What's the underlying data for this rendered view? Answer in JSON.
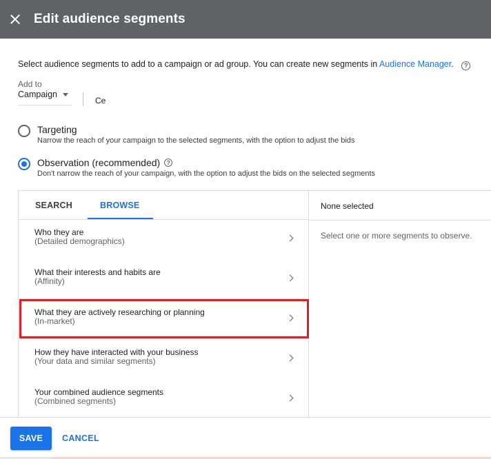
{
  "header": {
    "title": "Edit audience segments",
    "close_icon": "close-icon"
  },
  "intro": {
    "text": "Select audience segments to add to a campaign or ad group. You can create new segments in ",
    "link": "Audience Manager",
    "after": ".",
    "help_glyph": "?"
  },
  "add_to": {
    "label": "Add to",
    "value": "Campaign",
    "truncated": "Ce"
  },
  "options": {
    "targeting": {
      "title": "Targeting",
      "desc": "Narrow the reach of your campaign to the selected segments, with the option to adjust the bids",
      "selected": false
    },
    "observation": {
      "title": "Observation (recommended)",
      "desc": "Don't narrow the reach of your campaign, with the option to adjust the bids on the selected segments",
      "selected": true,
      "help_glyph": "?"
    }
  },
  "tabs": [
    {
      "label": "SEARCH",
      "active": false
    },
    {
      "label": "BROWSE",
      "active": true
    }
  ],
  "browse_items": [
    {
      "title": "Who they are",
      "sub": "(Detailed demographics)"
    },
    {
      "title": "What their interests and habits are",
      "sub": "(Affinity)"
    },
    {
      "title": "What they are actively researching or planning",
      "sub": "(In-market)",
      "highlighted": true
    },
    {
      "title": "How they have interacted with your business",
      "sub": "(Your data and similar segments)"
    },
    {
      "title": "Your combined audience segments",
      "sub": "(Combined segments)"
    }
  ],
  "selection": {
    "header": "None selected",
    "hint": "Select one or more segments to observe."
  },
  "footer": {
    "save_label": "SAVE",
    "cancel_label": "CANCEL"
  },
  "colors": {
    "header_bg": "#5f6368",
    "accent": "#1a73e8",
    "highlight": "#e01e23"
  }
}
